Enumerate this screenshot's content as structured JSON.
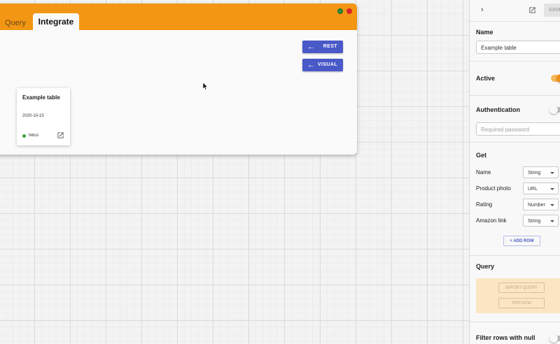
{
  "card": {
    "tabs": [
      {
        "label": "Query",
        "active": false
      },
      {
        "label": "Integrate",
        "active": true
      }
    ],
    "buttons": {
      "rest_label": "REST",
      "visual_label": "VISUAL"
    },
    "table_card": {
      "title": "Example table",
      "date": "2020-10-15",
      "status": "TABLE",
      "status_color": "#3aa53a"
    },
    "header_color": "#f29613"
  },
  "panel": {
    "save_label": "SAVE",
    "name_title": "Name",
    "name_value": "Example table",
    "active_title": "Active",
    "active_on": true,
    "auth_title": "Authentication",
    "auth_on": false,
    "password_placeholder": "Required password",
    "get_title": "Get",
    "get_rows": [
      {
        "label": "Name",
        "type": "String"
      },
      {
        "label": "Product photo",
        "type": "URL"
      },
      {
        "label": "Rating",
        "type": "Number"
      },
      {
        "label": "Amazon link",
        "type": "String"
      }
    ],
    "add_row_label": "ADD ROW",
    "query_title": "Query",
    "import_query_label": "IMPORT QUERY",
    "preview_label": "PREVIEW",
    "filter_title": "Filter rows with null"
  }
}
